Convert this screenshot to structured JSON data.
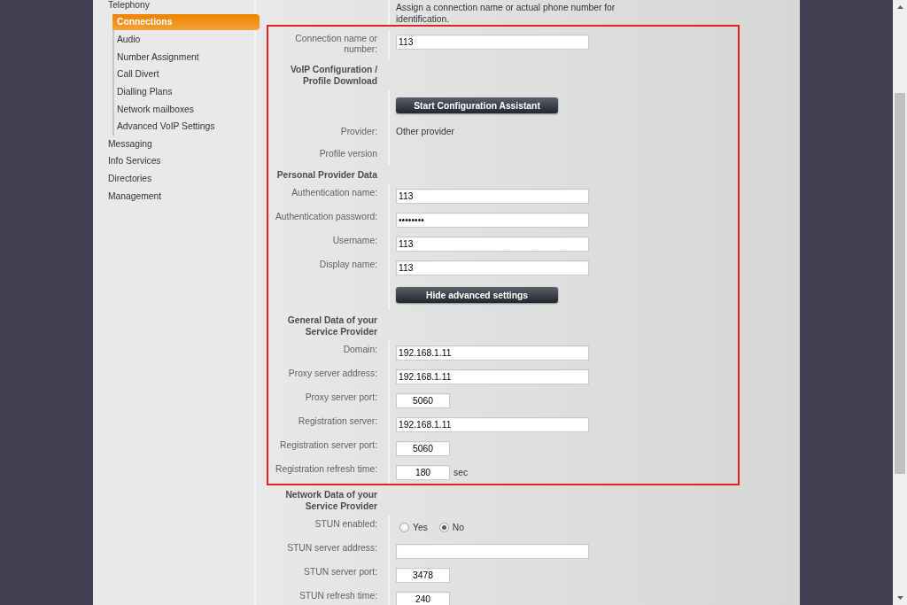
{
  "sidebar": {
    "items": [
      {
        "label": "Telephony",
        "selected": false,
        "children": [
          {
            "label": "Connections",
            "selected": true
          },
          {
            "label": "Audio",
            "selected": false
          },
          {
            "label": "Number Assignment",
            "selected": false
          },
          {
            "label": "Call Divert",
            "selected": false
          },
          {
            "label": "Dialling Plans",
            "selected": false
          },
          {
            "label": "Network mailboxes",
            "selected": false
          },
          {
            "label": "Advanced VoIP Settings",
            "selected": false
          }
        ]
      },
      {
        "label": "Messaging",
        "selected": false
      },
      {
        "label": "Info Services",
        "selected": false
      },
      {
        "label": "Directories",
        "selected": false
      },
      {
        "label": "Management",
        "selected": false
      }
    ]
  },
  "form": {
    "rows": [
      {
        "kind": "note",
        "text": "Assign a connection name or actual phone number for identification."
      },
      {
        "kind": "field",
        "label": "Connection name or number:",
        "value": "113"
      },
      {
        "kind": "heading",
        "label": "VoIP Configuration / Profile Download"
      },
      {
        "kind": "button",
        "label": "Start Configuration Assistant"
      },
      {
        "kind": "text",
        "label": "Provider:",
        "value": "Other provider"
      },
      {
        "kind": "text",
        "label": "Profile version"
      },
      {
        "kind": "heading",
        "label": "Personal Provider Data"
      },
      {
        "kind": "field",
        "label": "Authentication name:",
        "value": "113"
      },
      {
        "kind": "field",
        "label": "Authentication password:",
        "value": "••••••••"
      },
      {
        "kind": "field",
        "label": "Username:",
        "value": "113"
      },
      {
        "kind": "field",
        "label": "Display name:",
        "value": "113"
      },
      {
        "kind": "button",
        "label": "Hide advanced settings"
      },
      {
        "kind": "heading",
        "label": "General Data of your Service Provider"
      },
      {
        "kind": "field",
        "label": "Domain:",
        "value": "192.168.1.11"
      },
      {
        "kind": "field",
        "label": "Proxy server address:",
        "value": "192.168.1.11"
      },
      {
        "kind": "number",
        "label": "Proxy server port:",
        "value": "5060"
      },
      {
        "kind": "field",
        "label": "Registration server:",
        "value": "192.168.1.11"
      },
      {
        "kind": "number",
        "label": "Registration server port:",
        "value": "5060"
      },
      {
        "kind": "number",
        "label": "Registration refresh time:",
        "value": "180",
        "unit": "sec"
      },
      {
        "kind": "heading",
        "label": "Network Data of your Service Provider"
      },
      {
        "kind": "radio",
        "label": "STUN enabled:",
        "options": [
          {
            "label": "Yes",
            "selected": false
          },
          {
            "label": "No",
            "selected": true
          }
        ]
      },
      {
        "kind": "field",
        "label": "STUN server address:"
      },
      {
        "kind": "number",
        "label": "STUN server port:",
        "value": "3478"
      },
      {
        "kind": "number",
        "label": "STUN refresh time:",
        "value": "240"
      }
    ]
  }
}
